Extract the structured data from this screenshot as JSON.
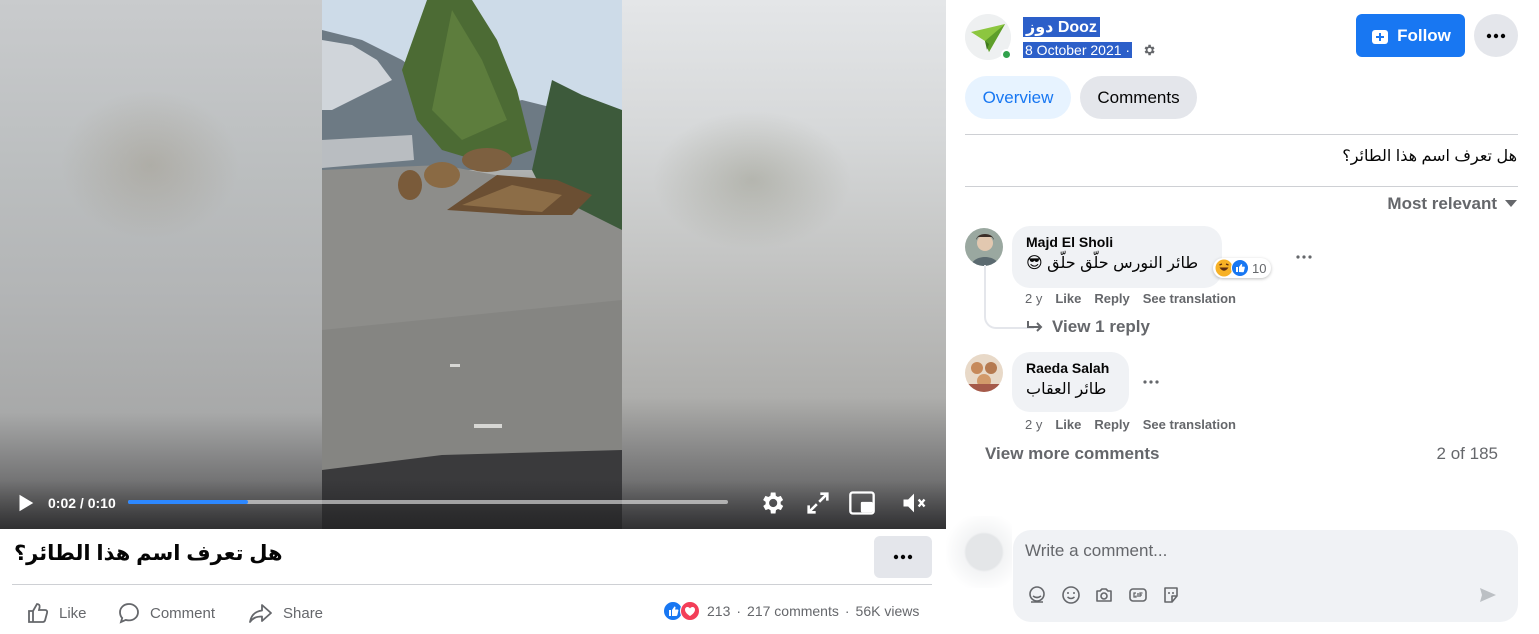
{
  "video": {
    "time_current": "0:02",
    "time_separator": "/",
    "time_total": "0:10",
    "progress_fraction": 0.2,
    "icons": [
      "play-icon",
      "settings-icon",
      "fullscreen-icon",
      "picture-in-picture-icon",
      "mute-icon"
    ]
  },
  "post": {
    "caption": "هل تعرف اسم هذا الطائر؟",
    "actions": {
      "like": "Like",
      "comment": "Comment",
      "share": "Share"
    },
    "stats": {
      "reactions": "213",
      "comments": "217 comments",
      "views": "56K views"
    }
  },
  "panel": {
    "page_name": "دوز Dooz",
    "date": "8 October 2021 ·",
    "follow_label": "Follow",
    "tabs": [
      {
        "label": "Overview",
        "active": true
      },
      {
        "label": "Comments",
        "active": false
      }
    ],
    "post_text": "هل تعرف اسم هذا الطائر؟",
    "sort_label": "Most relevant"
  },
  "comments": [
    {
      "author": "Majd El Sholi",
      "text": "طائر النورس حلّق حلّق 😎",
      "reaction_count": "10",
      "age": "2 y",
      "like": "Like",
      "reply": "Reply",
      "translate": "See translation"
    },
    {
      "author": "Raeda Salah",
      "text": "طائر العقاب",
      "age": "2 y",
      "like": "Like",
      "reply": "Reply",
      "translate": "See translation"
    }
  ],
  "view_reply_label": "View 1 reply",
  "view_more_label": "View more comments",
  "comment_count_label": "2 of 185",
  "composer": {
    "placeholder": "Write a comment..."
  },
  "colors": {
    "accent": "#1877f2",
    "like_blue": "#1877f2",
    "love_red": "#f33e58",
    "online_green": "#31a24c"
  }
}
